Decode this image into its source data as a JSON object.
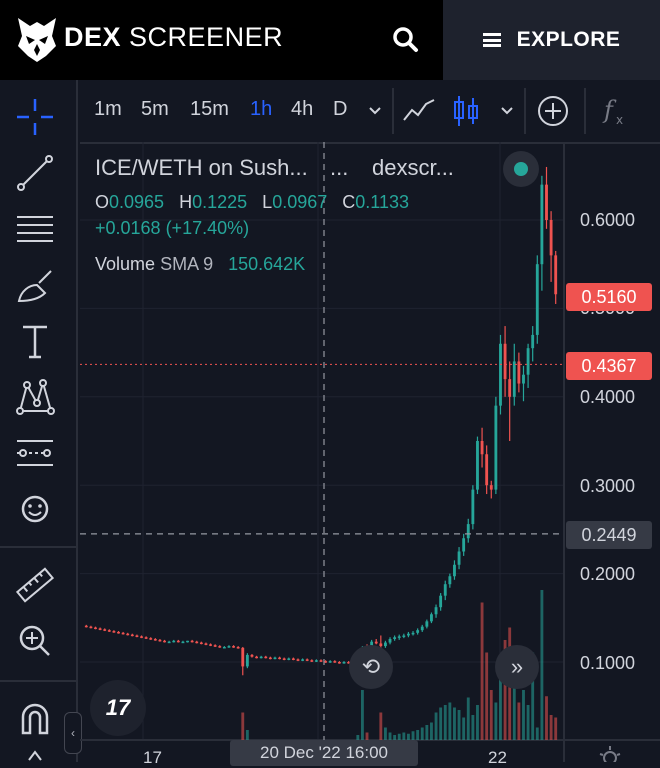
{
  "header": {
    "brand_bold": "DEX",
    "brand_rest": "SCREENER",
    "explore_label": "EXPLORE"
  },
  "toolbar": {
    "intervals": [
      "1m",
      "5m",
      "15m",
      "1h",
      "4h",
      "D"
    ],
    "active_interval": "1h"
  },
  "legend": {
    "pair": "ICE/WETH on Sush...",
    "dots": "...",
    "source": "dexscr...",
    "o_label": "O",
    "o": "0.0965",
    "h_label": "H",
    "h": "0.1225",
    "l_label": "L",
    "l": "0.0967",
    "c_label": "C",
    "c": "0.1133",
    "change": "+0.0168 (+17.40%)",
    "volume_label": "Volume",
    "volume_sma": "SMA 9",
    "volume_value": "150.642K"
  },
  "price_axis": {
    "ticks": [
      "0.6000",
      "0.5000",
      "0.4000",
      "0.3000",
      "0.2000",
      "0.1000"
    ],
    "last_price_tag": "0.5160",
    "marker_tag": "0.4367",
    "crosshair_tag": "0.2449"
  },
  "time_axis": {
    "ticks": [
      "17",
      "22"
    ],
    "crosshair_label": "20 Dec '22  16:00"
  },
  "colors": {
    "up": "#26a69a",
    "down": "#ef5350",
    "background": "#131722",
    "accent": "#2962ff"
  },
  "chart_data": {
    "type": "candlestick",
    "ylim": [
      0.0,
      0.63
    ],
    "yticks": [
      0.1,
      0.2,
      0.3,
      0.4,
      0.5,
      0.6
    ],
    "xticks": [
      "17",
      "22"
    ],
    "last_price": 0.516,
    "marked_price": 0.4367,
    "crosshair_price": 0.2449,
    "ohlc": [
      [
        0.141,
        0.142,
        0.139,
        0.14
      ],
      [
        0.14,
        0.141,
        0.138,
        0.139
      ],
      [
        0.139,
        0.14,
        0.137,
        0.138
      ],
      [
        0.138,
        0.139,
        0.136,
        0.137
      ],
      [
        0.137,
        0.138,
        0.135,
        0.136
      ],
      [
        0.136,
        0.137,
        0.134,
        0.135
      ],
      [
        0.135,
        0.136,
        0.133,
        0.134
      ],
      [
        0.134,
        0.135,
        0.132,
        0.133
      ],
      [
        0.133,
        0.134,
        0.131,
        0.132
      ],
      [
        0.132,
        0.133,
        0.13,
        0.131
      ],
      [
        0.131,
        0.132,
        0.129,
        0.13
      ],
      [
        0.13,
        0.131,
        0.128,
        0.129
      ],
      [
        0.129,
        0.13,
        0.127,
        0.128
      ],
      [
        0.128,
        0.129,
        0.126,
        0.127
      ],
      [
        0.127,
        0.128,
        0.125,
        0.126
      ],
      [
        0.126,
        0.127,
        0.124,
        0.125
      ],
      [
        0.125,
        0.126,
        0.123,
        0.124
      ],
      [
        0.124,
        0.125,
        0.122,
        0.123
      ],
      [
        0.123,
        0.124,
        0.122,
        0.123
      ],
      [
        0.123,
        0.125,
        0.122,
        0.124
      ],
      [
        0.124,
        0.125,
        0.122,
        0.123
      ],
      [
        0.123,
        0.124,
        0.122,
        0.123
      ],
      [
        0.123,
        0.124,
        0.122,
        0.124
      ],
      [
        0.124,
        0.125,
        0.122,
        0.123
      ],
      [
        0.123,
        0.124,
        0.121,
        0.122
      ],
      [
        0.122,
        0.123,
        0.12,
        0.121
      ],
      [
        0.121,
        0.122,
        0.119,
        0.12
      ],
      [
        0.12,
        0.121,
        0.118,
        0.119
      ],
      [
        0.119,
        0.12,
        0.117,
        0.118
      ],
      [
        0.118,
        0.119,
        0.116,
        0.117
      ],
      [
        0.117,
        0.118,
        0.116,
        0.117
      ],
      [
        0.117,
        0.119,
        0.116,
        0.118
      ],
      [
        0.118,
        0.119,
        0.116,
        0.117
      ],
      [
        0.117,
        0.118,
        0.115,
        0.116
      ],
      [
        0.116,
        0.117,
        0.085,
        0.095
      ],
      [
        0.095,
        0.11,
        0.093,
        0.108
      ],
      [
        0.108,
        0.109,
        0.105,
        0.106
      ],
      [
        0.106,
        0.107,
        0.104,
        0.105
      ],
      [
        0.105,
        0.107,
        0.104,
        0.106
      ],
      [
        0.106,
        0.107,
        0.104,
        0.105
      ],
      [
        0.105,
        0.106,
        0.103,
        0.104
      ],
      [
        0.104,
        0.106,
        0.103,
        0.105
      ],
      [
        0.105,
        0.106,
        0.103,
        0.104
      ],
      [
        0.104,
        0.105,
        0.102,
        0.103
      ],
      [
        0.103,
        0.105,
        0.102,
        0.104
      ],
      [
        0.104,
        0.105,
        0.102,
        0.103
      ],
      [
        0.103,
        0.104,
        0.101,
        0.102
      ],
      [
        0.102,
        0.104,
        0.101,
        0.103
      ],
      [
        0.103,
        0.104,
        0.101,
        0.102
      ],
      [
        0.102,
        0.103,
        0.1,
        0.101
      ],
      [
        0.101,
        0.103,
        0.1,
        0.102
      ],
      [
        0.102,
        0.103,
        0.1,
        0.101
      ],
      [
        0.101,
        0.102,
        0.099,
        0.1
      ],
      [
        0.1,
        0.102,
        0.099,
        0.101
      ],
      [
        0.101,
        0.102,
        0.099,
        0.1
      ],
      [
        0.1,
        0.101,
        0.098,
        0.099
      ],
      [
        0.099,
        0.101,
        0.098,
        0.1
      ],
      [
        0.1,
        0.101,
        0.098,
        0.099
      ],
      [
        0.099,
        0.101,
        0.098,
        0.1
      ],
      [
        0.1,
        0.102,
        0.099,
        0.101
      ],
      [
        0.101,
        0.118,
        0.1,
        0.115
      ],
      [
        0.115,
        0.12,
        0.112,
        0.113
      ],
      [
        0.113,
        0.125,
        0.112,
        0.123
      ],
      [
        0.123,
        0.126,
        0.12,
        0.121
      ],
      [
        0.121,
        0.13,
        0.115,
        0.118
      ],
      [
        0.118,
        0.124,
        0.116,
        0.122
      ],
      [
        0.122,
        0.128,
        0.12,
        0.126
      ],
      [
        0.126,
        0.13,
        0.124,
        0.128
      ],
      [
        0.128,
        0.131,
        0.125,
        0.129
      ],
      [
        0.129,
        0.132,
        0.127,
        0.13
      ],
      [
        0.13,
        0.134,
        0.128,
        0.132
      ],
      [
        0.132,
        0.135,
        0.13,
        0.133
      ],
      [
        0.133,
        0.138,
        0.131,
        0.136
      ],
      [
        0.136,
        0.142,
        0.134,
        0.14
      ],
      [
        0.14,
        0.148,
        0.138,
        0.146
      ],
      [
        0.146,
        0.156,
        0.144,
        0.154
      ],
      [
        0.154,
        0.165,
        0.15,
        0.162
      ],
      [
        0.162,
        0.178,
        0.158,
        0.175
      ],
      [
        0.175,
        0.192,
        0.17,
        0.188
      ],
      [
        0.188,
        0.2,
        0.184,
        0.197
      ],
      [
        0.197,
        0.215,
        0.193,
        0.21
      ],
      [
        0.21,
        0.23,
        0.205,
        0.225
      ],
      [
        0.225,
        0.245,
        0.22,
        0.24
      ],
      [
        0.24,
        0.262,
        0.235,
        0.256
      ],
      [
        0.256,
        0.3,
        0.25,
        0.295
      ],
      [
        0.295,
        0.355,
        0.29,
        0.35
      ],
      [
        0.35,
        0.365,
        0.32,
        0.335
      ],
      [
        0.335,
        0.345,
        0.29,
        0.3
      ],
      [
        0.3,
        0.305,
        0.285,
        0.295
      ],
      [
        0.295,
        0.4,
        0.29,
        0.39
      ],
      [
        0.39,
        0.47,
        0.38,
        0.46
      ],
      [
        0.46,
        0.48,
        0.4,
        0.42
      ],
      [
        0.42,
        0.44,
        0.35,
        0.4
      ],
      [
        0.4,
        0.46,
        0.39,
        0.44
      ],
      [
        0.44,
        0.45,
        0.405,
        0.415
      ],
      [
        0.415,
        0.435,
        0.395,
        0.425
      ],
      [
        0.425,
        0.46,
        0.41,
        0.455
      ],
      [
        0.455,
        0.48,
        0.44,
        0.47
      ],
      [
        0.47,
        0.56,
        0.46,
        0.55
      ],
      [
        0.55,
        0.65,
        0.52,
        0.64
      ],
      [
        0.64,
        0.66,
        0.59,
        0.6
      ],
      [
        0.6,
        0.61,
        0.53,
        0.56
      ],
      [
        0.56,
        0.565,
        0.505,
        0.516
      ]
    ],
    "volume": [
      0,
      0,
      0,
      0,
      0,
      0,
      0,
      0,
      0,
      0,
      0,
      0,
      0,
      0,
      0,
      0,
      0,
      0,
      0,
      0,
      0,
      0,
      0,
      0,
      0,
      0,
      0,
      0,
      0,
      0,
      0,
      0,
      0,
      0,
      22,
      8,
      0,
      0,
      0,
      0,
      0,
      0,
      0,
      0,
      0,
      0,
      0,
      0,
      0,
      0,
      0,
      0,
      0,
      0,
      0,
      0,
      0,
      0,
      0,
      4,
      40,
      6,
      0,
      0,
      22,
      10,
      6,
      4,
      5,
      6,
      5,
      7,
      8,
      10,
      12,
      14,
      22,
      26,
      28,
      30,
      26,
      24,
      18,
      34,
      20,
      28,
      110,
      70,
      40,
      30,
      55,
      80,
      90,
      48,
      30,
      40,
      28,
      70,
      10,
      120,
      35,
      20,
      18
    ]
  }
}
